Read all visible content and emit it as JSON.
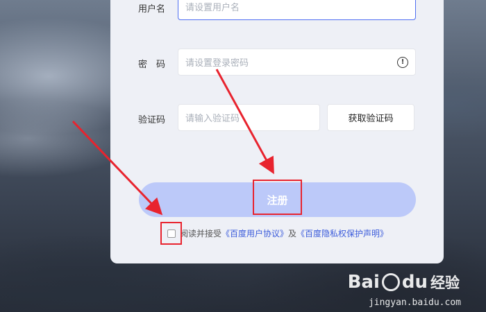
{
  "form": {
    "username_label": "用户名",
    "username_placeholder": "请设置用户名",
    "password_label": "密　码",
    "password_placeholder": "请设置登录密码",
    "code_label": "验证码",
    "code_placeholder": "请输入验证码",
    "get_code_label": "获取验证码",
    "submit_label": "注册",
    "agree_prefix": "阅读并接受",
    "agree_link1": "《百度用户协议》",
    "agree_mid": "及",
    "agree_link2": "《百度隐私权保护声明》"
  },
  "icons": {
    "password_info": "info-circle-icon"
  },
  "colors": {
    "accent": "#4e6ef2",
    "submit_bg": "#bcc9f9",
    "annotation": "#e8232e",
    "link": "#3b5bdb"
  },
  "watermark": {
    "brand": "Bai",
    "brand2": "du",
    "site_name": "经验",
    "url": "jingyan.baidu.com"
  }
}
